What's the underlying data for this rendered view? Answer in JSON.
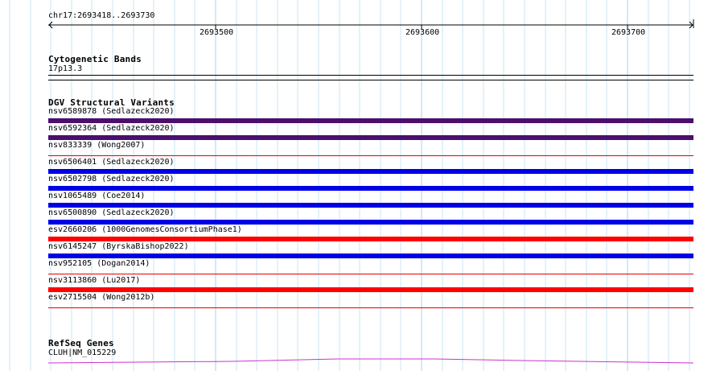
{
  "ruler": {
    "coordinates": "chr17:2693418..2693730",
    "ticks": [
      {
        "label": "2693500",
        "value": 2693500
      },
      {
        "label": "2693600",
        "value": 2693600
      },
      {
        "label": "2693700",
        "value": 2693700
      }
    ]
  },
  "cytogenetic": {
    "title": "Cytogenetic Bands",
    "band": "17p13.3"
  },
  "dgv": {
    "title": "DGV Structural Variants",
    "variants": [
      {
        "label": "nsv6589878 (Sedlazeck2020)",
        "color": "#4b0f6e",
        "style": "thick"
      },
      {
        "label": "nsv6592364 (Sedlazeck2020)",
        "color": "#4b0f6e",
        "style": "thick"
      },
      {
        "label": "nsv833339 (Wong2007)",
        "color": "#e60000",
        "style": "thin"
      },
      {
        "label": "nsv6506401 (Sedlazeck2020)",
        "color": "#0000e6",
        "style": "thick"
      },
      {
        "label": "nsv6502798 (Sedlazeck2020)",
        "color": "#0000e6",
        "style": "thick"
      },
      {
        "label": "nsv1065489 (Coe2014)",
        "color": "#0000e6",
        "style": "thick"
      },
      {
        "label": "nsv6500890 (Sedlazeck2020)",
        "color": "#0000e6",
        "style": "thick"
      },
      {
        "label": "esv2660206 (1000GenomesConsortiumPhase1)",
        "color": "#ff0000",
        "style": "thick"
      },
      {
        "label": "nsv6145247 (ByrskaBishop2022)",
        "color": "#0000e6",
        "style": "thick"
      },
      {
        "label": "nsv952105 (Dogan2014)",
        "color": "#e60000",
        "style": "thin"
      },
      {
        "label": "nsv3113860 (Lu2017)",
        "color": "#ff0000",
        "style": "thick"
      },
      {
        "label": "esv2715504 (Wong2012b)",
        "color": "#e60000",
        "style": "thin"
      }
    ]
  },
  "refseq": {
    "title": "RefSeq Genes",
    "gene": "CLUH|NM_015229",
    "color": "#cc33cc"
  }
}
